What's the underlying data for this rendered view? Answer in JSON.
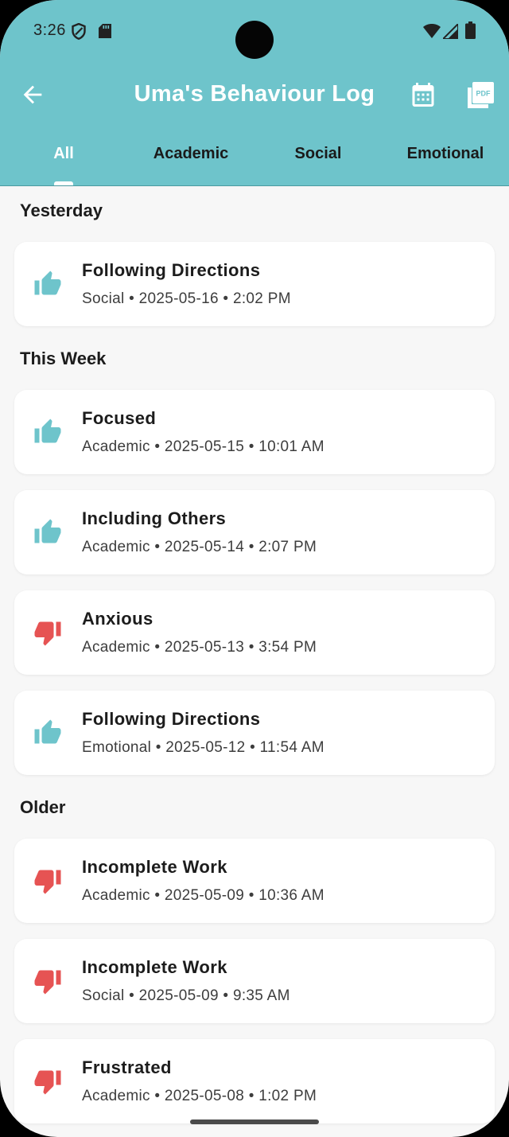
{
  "status_bar": {
    "time": "3:26"
  },
  "app_bar": {
    "title": "Uma's Behaviour Log",
    "back_icon": "arrow-left-icon",
    "calendar_icon": "calendar-icon",
    "pdf_icon": "pdf-icon",
    "pdf_icon_label": "PDF"
  },
  "tabs": [
    {
      "label": "All",
      "active": true
    },
    {
      "label": "Academic",
      "active": false
    },
    {
      "label": "Social",
      "active": false
    },
    {
      "label": "Emotional",
      "active": false
    }
  ],
  "colors": {
    "accent": "#6ec4cb",
    "positive": "#6ec4cb",
    "negative": "#e65353"
  },
  "sections": [
    {
      "heading": "Yesterday",
      "entries": [
        {
          "title": "Following Directions",
          "meta": "Social • 2025-05-16 • 2:02 PM",
          "icon": "thumbs-up-icon"
        }
      ]
    },
    {
      "heading": "This Week",
      "entries": [
        {
          "title": "Focused",
          "meta": "Academic • 2025-05-15 • 10:01 AM",
          "icon": "thumbs-up-icon"
        },
        {
          "title": "Including Others",
          "meta": "Academic • 2025-05-14 • 2:07 PM",
          "icon": "thumbs-up-icon"
        },
        {
          "title": "Anxious",
          "meta": "Academic • 2025-05-13 • 3:54 PM",
          "icon": "thumbs-down-icon"
        },
        {
          "title": "Following Directions",
          "meta": "Emotional • 2025-05-12 • 11:54 AM",
          "icon": "thumbs-up-icon"
        }
      ]
    },
    {
      "heading": "Older",
      "entries": [
        {
          "title": "Incomplete Work",
          "meta": "Academic • 2025-05-09 • 10:36 AM",
          "icon": "thumbs-down-icon"
        },
        {
          "title": "Incomplete Work",
          "meta": "Social • 2025-05-09 • 9:35 AM",
          "icon": "thumbs-down-icon"
        },
        {
          "title": "Frustrated",
          "meta": "Academic • 2025-05-08 • 1:02 PM",
          "icon": "thumbs-down-icon"
        }
      ]
    }
  ]
}
